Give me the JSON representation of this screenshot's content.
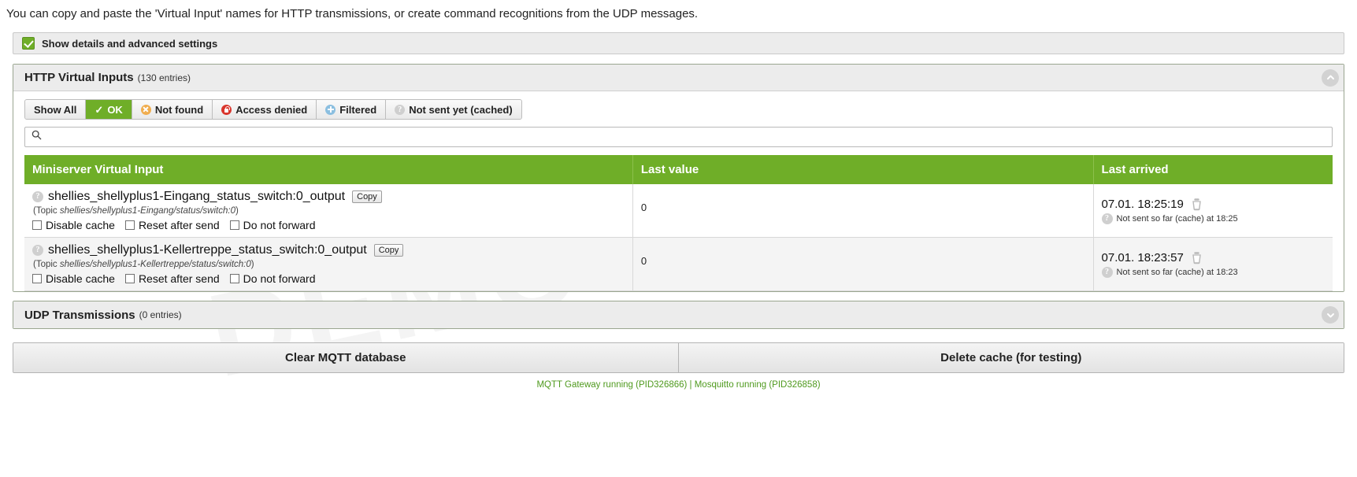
{
  "intro_text": "You can copy and paste the 'Virtual Input' names for HTTP transmissions, or create command recognitions from the UDP messages.",
  "advanced": {
    "label": "Show details and advanced settings",
    "checked": true
  },
  "http_panel": {
    "title": "HTTP Virtual Inputs",
    "count_label": "(130 entries)",
    "collapse_icon": "chevron-up-icon",
    "tabs": [
      {
        "label": "Show All",
        "icon": "none",
        "active": false
      },
      {
        "label": "OK",
        "icon": "check-icon",
        "active": true
      },
      {
        "label": "Not found",
        "icon": "warning-circle-icon",
        "active": false
      },
      {
        "label": "Access denied",
        "icon": "lock-circle-icon",
        "active": false
      },
      {
        "label": "Filtered",
        "icon": "plus-circle-icon",
        "active": false
      },
      {
        "label": "Not sent yet (cached)",
        "icon": "question-circle-icon",
        "active": false
      }
    ],
    "search": {
      "value": "",
      "placeholder": "",
      "icon": "search-icon"
    },
    "columns": [
      "Miniserver Virtual Input",
      "Last value",
      "Last arrived"
    ],
    "rows": [
      {
        "help_icon": "question-icon",
        "name": "shellies_shellyplus1-Eingang_status_switch:0_output",
        "copy_label": "Copy",
        "topic_prefix": "(Topic ",
        "topic": "shellies/shellyplus1-Eingang/status/switch:0",
        "topic_suffix": ")",
        "options": [
          "Disable cache",
          "Reset after send",
          "Do not forward"
        ],
        "last_value": "0",
        "last_arrived": "07.01. 18:25:19",
        "delete_icon": "trash-icon",
        "sub_help_icon": "question-icon",
        "sub_note": "Not sent so far (cache) at 18:25"
      },
      {
        "help_icon": "question-icon",
        "name": "shellies_shellyplus1-Kellertreppe_status_switch:0_output",
        "copy_label": "Copy",
        "topic_prefix": "(Topic ",
        "topic": "shellies/shellyplus1-Kellertreppe/status/switch:0",
        "topic_suffix": ")",
        "options": [
          "Disable cache",
          "Reset after send",
          "Do not forward"
        ],
        "last_value": "0",
        "last_arrived": "07.01. 18:23:57",
        "delete_icon": "trash-icon",
        "sub_help_icon": "question-icon",
        "sub_note": "Not sent so far (cache) at 18:23"
      }
    ]
  },
  "udp_panel": {
    "title": "UDP Transmissions",
    "count_label": "(0 entries)",
    "collapse_icon": "chevron-down-icon"
  },
  "actions": [
    {
      "label": "Clear MQTT database"
    },
    {
      "label": "Delete cache (for testing)"
    }
  ],
  "status_text": "MQTT Gateway running (PID326866) | Mosquitto running (PID326858)",
  "watermark": "DEMOVERSION",
  "colors": {
    "accent_green": "#6fae28",
    "status_green": "#4f9a1e",
    "panel_grey": "#ececec"
  }
}
